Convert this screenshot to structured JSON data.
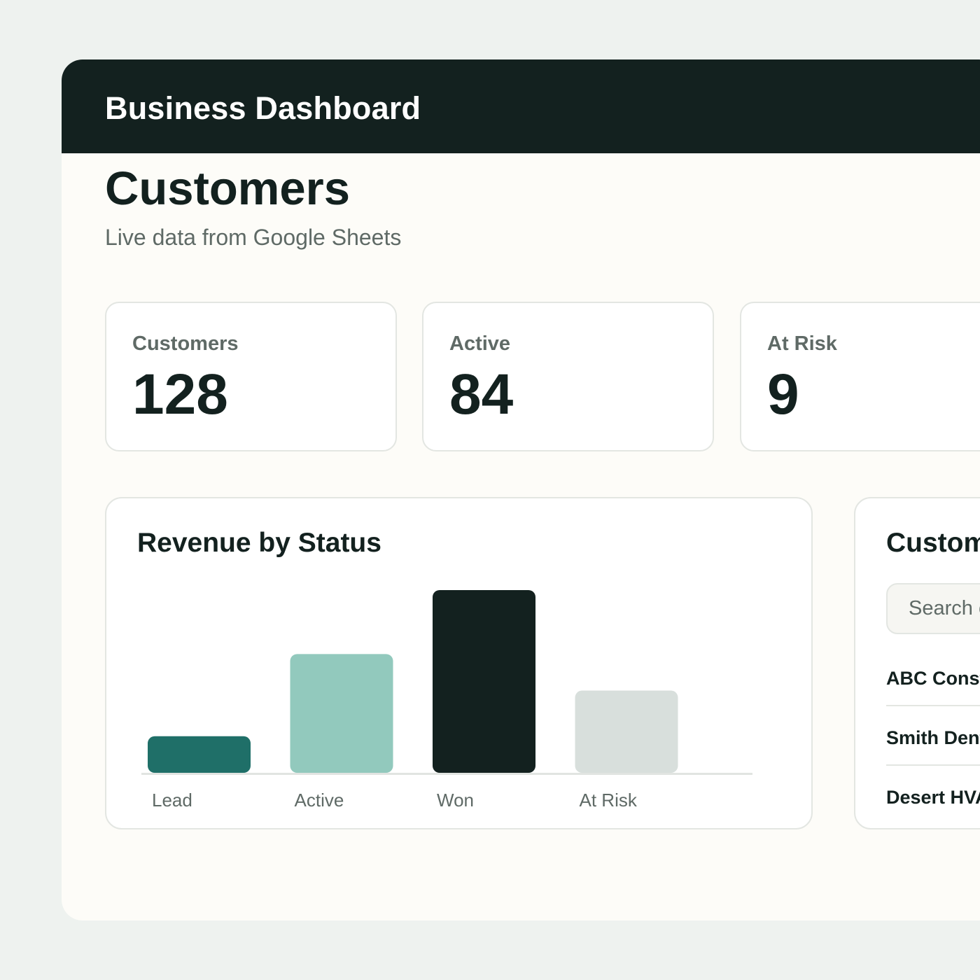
{
  "app": {
    "title": "Business Dashboard"
  },
  "page": {
    "title": "Customers",
    "subtitle": "Live data from Google Sheets"
  },
  "stats": [
    {
      "label": "Customers",
      "value": "128"
    },
    {
      "label": "Active",
      "value": "84"
    },
    {
      "label": "At Risk",
      "value": "9"
    }
  ],
  "chart_card": {
    "title": "Revenue by Status"
  },
  "chart_data": {
    "type": "bar",
    "title": "Revenue by Status",
    "categories": [
      "Lead",
      "Active",
      "Won",
      "At Risk"
    ],
    "values": [
      20,
      65,
      100,
      45
    ],
    "colors": [
      "#1f6f68",
      "#92c9bd",
      "#13211f",
      "#d8dfdc"
    ],
    "ylim": [
      0,
      100
    ],
    "grid": false,
    "xlabel": "",
    "ylabel": ""
  },
  "customers_panel": {
    "title": "Customers",
    "search_placeholder": "Search customers",
    "items": [
      "ABC Construction",
      "Smith Dental",
      "Desert HVAC"
    ]
  },
  "colors": {
    "header_bg": "#13211f",
    "page_bg": "#fdfcf8",
    "outer_bg": "#eef2ef",
    "accent": "#1f6f68",
    "muted_text": "#5f6a66"
  }
}
